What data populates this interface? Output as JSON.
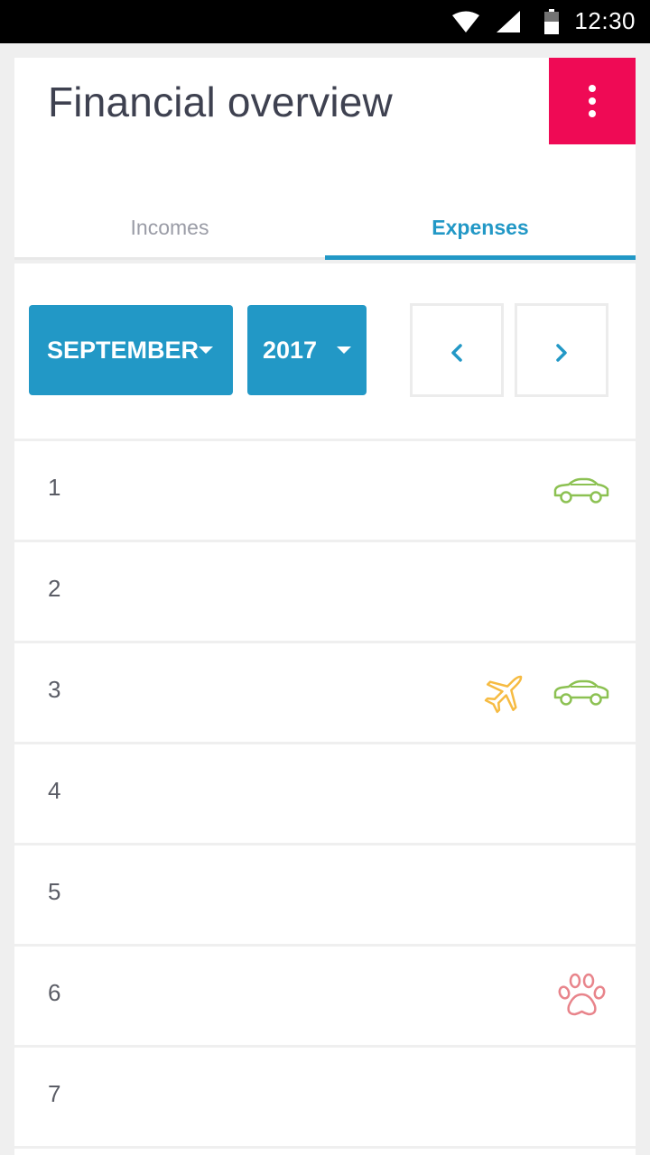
{
  "status_bar": {
    "time": "12:30",
    "icons": [
      "wifi-icon",
      "cell-signal-icon",
      "battery-icon"
    ]
  },
  "header": {
    "title": "Financial overview",
    "menu_icon": "more-vert-icon",
    "menu_color": "#ef0a55"
  },
  "tabs": [
    {
      "label": "Incomes",
      "active": false
    },
    {
      "label": "Expenses",
      "active": true
    }
  ],
  "filters": {
    "month": "SEPTEMBER",
    "year": "2017",
    "prev_icon": "chevron-left-icon",
    "next_icon": "chevron-right-icon",
    "accent_color": "#2298c6"
  },
  "days": [
    {
      "day": "1",
      "icons": [
        "car-icon"
      ]
    },
    {
      "day": "2",
      "icons": []
    },
    {
      "day": "3",
      "icons": [
        "plane-icon",
        "car-icon"
      ]
    },
    {
      "day": "4",
      "icons": []
    },
    {
      "day": "5",
      "icons": []
    },
    {
      "day": "6",
      "icons": [
        "paw-icon"
      ]
    },
    {
      "day": "7",
      "icons": []
    }
  ],
  "icon_colors": {
    "car-icon": "#8cc152",
    "plane-icon": "#f6bb42",
    "paw-icon": "#e8848b"
  }
}
